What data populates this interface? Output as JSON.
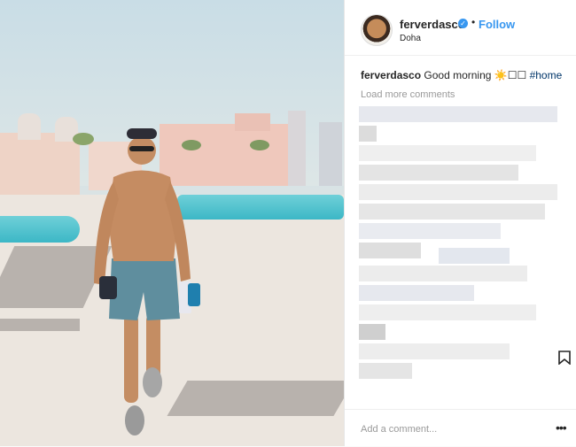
{
  "post": {
    "username": "ferverdasco",
    "follow_label": "Follow",
    "separator": "•",
    "location": "Doha",
    "caption": {
      "username": "ferverdasco",
      "text": "Good morning ☀️☐☐",
      "hashtag": "#home"
    },
    "load_more": "Load more comments",
    "add_comment_placeholder": "Add a comment...",
    "more_options": "•••"
  },
  "colors": {
    "link": "#3897f0",
    "hashtag": "#003569",
    "muted": "#999999"
  }
}
